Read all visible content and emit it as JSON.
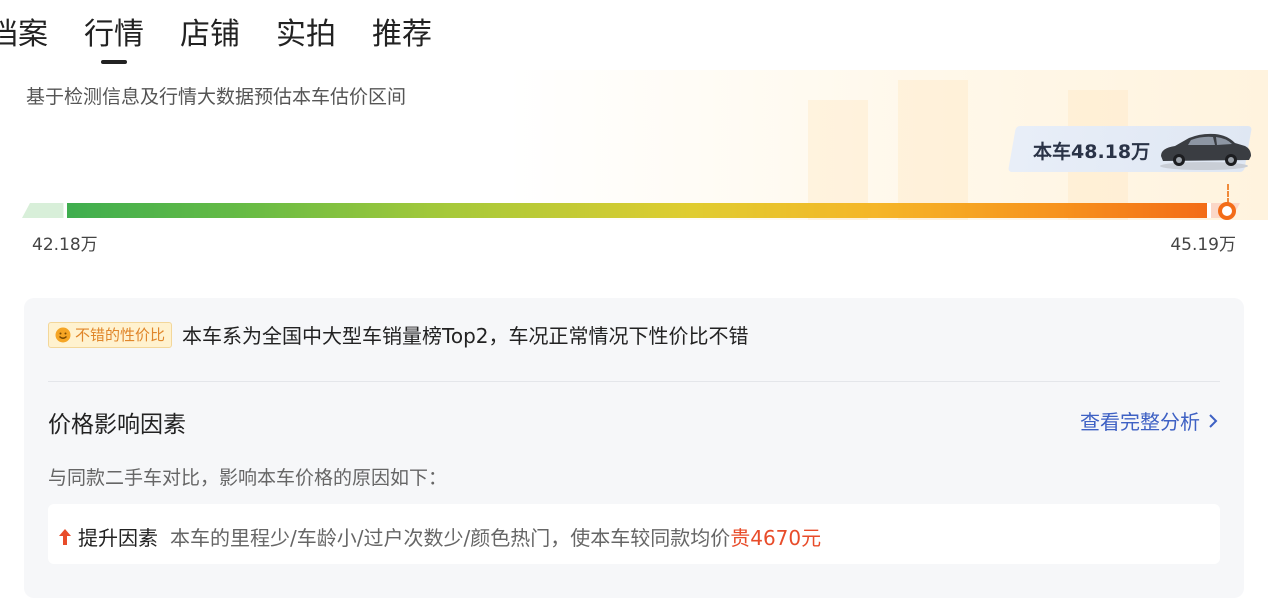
{
  "tabs": [
    "档案",
    "行情",
    "店铺",
    "实拍",
    "推荐"
  ],
  "price_panel": {
    "subtitle": "基于检测信息及行情大数据预估本车估价区间",
    "current_price_label": "本车48.18万",
    "min_label": "42.18万",
    "max_label": "45.19万",
    "current_position_fraction": 0.99,
    "colors": {
      "bar_start": "#3fae4f",
      "bar_mid": "#e0cc2f",
      "bar_end": "#f36c17"
    }
  },
  "analysis": {
    "badge_icon": "smile-icon",
    "badge_label": "不错的性价比",
    "badge_text": "本车系为全国中大型车销量榜Top2，车况正常情况下性价比不错",
    "factor_title": "价格影响因素",
    "view_all_label": "查看完整分析",
    "compare_text": "与同款二手车对比，影响本车价格的原因如下：",
    "factor": {
      "icon": "arrow-up-icon",
      "label": "提升因素",
      "desc": "本车的里程少/车龄小/过户次数少/颜色热门，使本车较同款均价",
      "highlight": "贵4670元"
    }
  }
}
